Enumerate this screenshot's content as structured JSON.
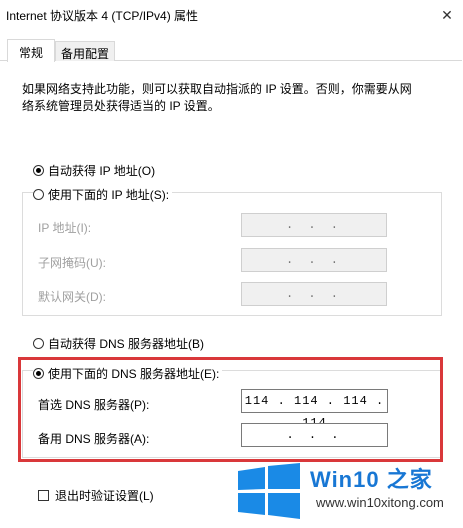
{
  "window": {
    "title": "Internet 协议版本 4 (TCP/IPv4) 属性",
    "close_glyph": "✕"
  },
  "tabs": [
    {
      "label": "常规",
      "active": true
    },
    {
      "label": "备用配置",
      "active": false
    }
  ],
  "description": {
    "line1": "如果网络支持此功能，则可以获取自动指派的 IP 设置。否则，你需要从网",
    "line2": "络系统管理员处获得适当的 IP 设置。"
  },
  "ip_section": {
    "auto_radio": {
      "label": "自动获得 IP 地址(O)",
      "checked": true
    },
    "manual_radio": {
      "label": "使用下面的 IP 地址(S):",
      "checked": false
    },
    "fields": [
      {
        "label": "IP 地址(I):",
        "value": ". . ."
      },
      {
        "label": "子网掩码(U):",
        "value": ". . ."
      },
      {
        "label": "默认网关(D):",
        "value": ". . ."
      }
    ]
  },
  "dns_section": {
    "auto_radio": {
      "label": "自动获得 DNS 服务器地址(B)",
      "checked": false
    },
    "manual_radio": {
      "label": "使用下面的 DNS 服务器地址(E):",
      "checked": true
    },
    "preferred": {
      "label": "首选 DNS 服务器(P):",
      "value": "114 . 114 . 114 . 114"
    },
    "alternate": {
      "label": "备用 DNS 服务器(A):",
      "value": ". . ."
    }
  },
  "validate_checkbox": {
    "label": "退出时验证设置(L)",
    "checked": false
  },
  "watermark": {
    "title": "Win10 之家",
    "url": "www.win10xitong.com"
  },
  "colors": {
    "highlight": "#d9383a",
    "brand": "#1877d4"
  }
}
